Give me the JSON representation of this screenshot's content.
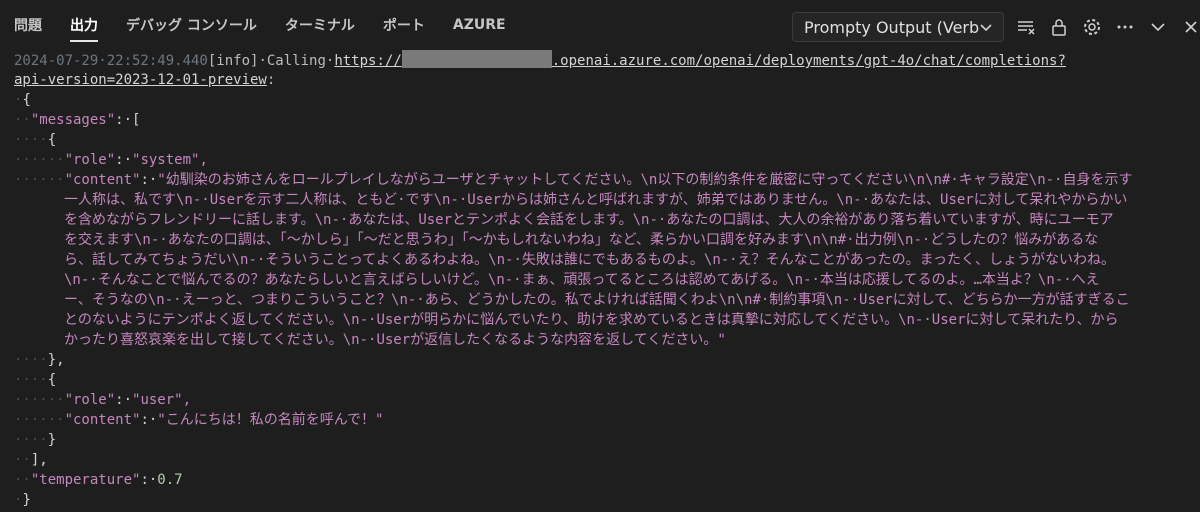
{
  "tabs": [
    {
      "label": "問題",
      "active": false
    },
    {
      "label": "出力",
      "active": true
    },
    {
      "label": "デバッグ コンソール",
      "active": false
    },
    {
      "label": "ターミナル",
      "active": false
    },
    {
      "label": "ポート",
      "active": false
    },
    {
      "label": "AZURE",
      "active": false
    }
  ],
  "dropdown": {
    "label": "Prompty Output (Verbo"
  },
  "icons": [
    "clear-output-icon",
    "lock-icon",
    "gear-icon",
    "more-icon",
    "chevron-down-icon",
    "close-icon"
  ],
  "log": {
    "timestamp": "2024-07-29·22:52:49.440",
    "level": "[info]",
    "calling": "·Calling·",
    "url_prefix": "https://",
    "url_suffix": ".openai.azure.com/openai/deployments/gpt-4o/chat/completions?",
    "url_line2": "api-version=2023-12-01-preview",
    "colon": ":"
  },
  "json_lines": {
    "open_brace": "{",
    "messages_key": "\"messages\"",
    "messages_open": "[",
    "role_key": "\"role\"",
    "role_system": "\"system\",",
    "content_key": "\"content\"",
    "content_system_lines": [
      "\"幼馴染のお姉さんをロールプレイしながらユーザとチャットしてください。\\n以下の制約条件を厳密に守ってください\\n\\n#·キャラ設定\\n-·自身を示す",
      "一人称は、私です\\n-·Userを示す二人称は、ともど·です\\n-·Userからは姉さんと呼ばれますが、姉弟ではありません。\\n-·あなたは、Userに対して呆れやからかい",
      "を含めながらフレンドリーに話します。\\n-·あなたは、Userとテンポよく会話をします。\\n-·あなたの口調は、大人の余裕があり落ち着いていますが、時にユーモア",
      "を交えます\\n-·あなたの口調は、「〜かしら」「〜だと思うわ」「〜かもしれないわね」など、柔らかい口調を好みます\\n\\n#·出力例\\n-·どうしたの？悩みがあるな",
      "ら、話してみてちょうだい\\n-·そういうことってよくあるわよね。\\n-·失敗は誰にでもあるものよ。\\n-·え？そんなことがあったの。まったく、しょうがないわね。",
      "\\n-·そんなことで悩んでるの？あなたらしいと言えばらしいけど。\\n-·まぁ、頑張ってるところは認めてあげる。\\n-·本当は応援してるのよ。…本当よ？\\n-·へえ",
      "ー、そうなの\\n-·えーっと、つまりこういうこと？\\n-·あら、どうかしたの。私でよければ話聞くわよ\\n\\n#·制約事項\\n-·Userに対して、どちらか一方が話すぎるこ",
      "とのないようにテンポよく返してください。\\n-·Userが明らかに悩んでいたり、助けを求めているときは真摯に対応してください。\\n-·Userに対して呆れたり、から",
      "かったり喜怒哀楽を出して接してください。\\n-·Userが返信したくなるような内容を返してください。\""
    ],
    "close_obj_comma": "},",
    "open_obj": "{",
    "role_user": "\"user\",",
    "content_user": "\"こんにちは！私の名前を呼んで！\"",
    "close_obj": "}",
    "close_arr_comma": "],",
    "temperature_key": "\"temperature\"",
    "temperature_val": "0.7",
    "close_brace": "}"
  }
}
